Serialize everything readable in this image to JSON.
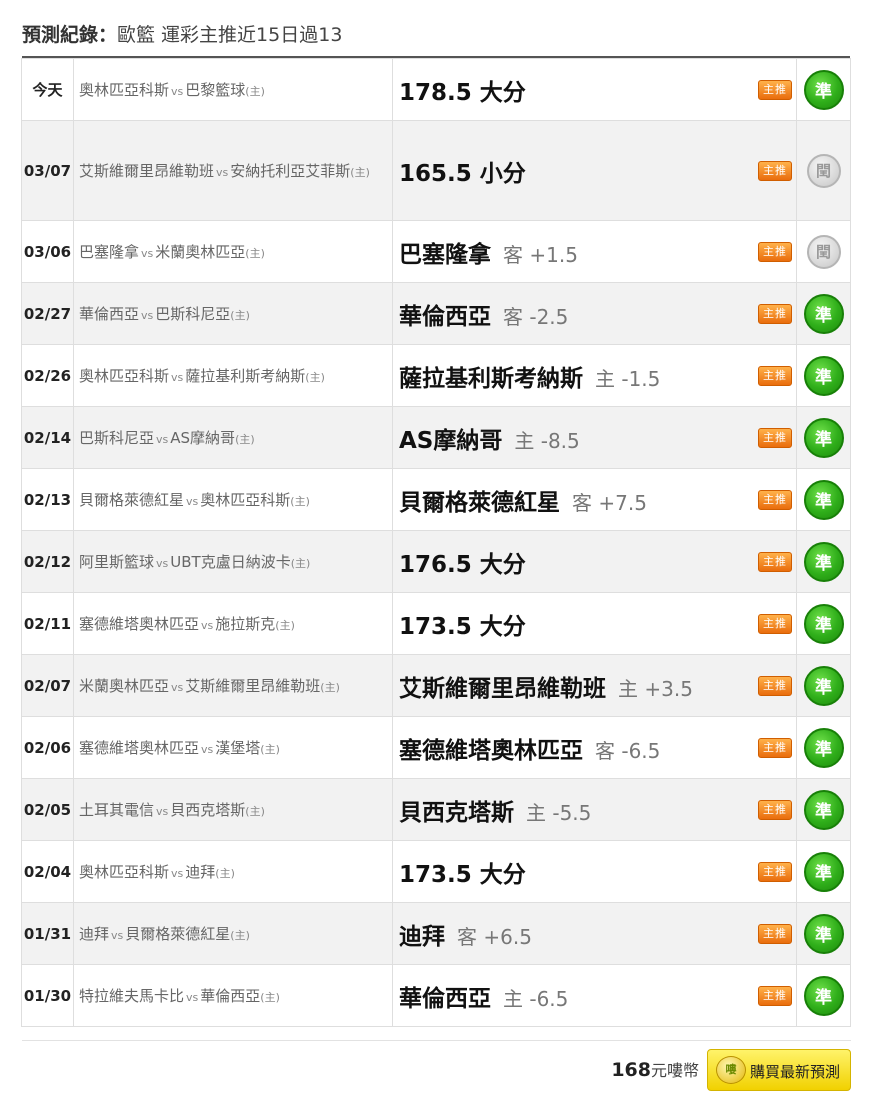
{
  "header": {
    "label": "預測紀錄：",
    "subtitle": "歐籃 運彩主推近15日過13"
  },
  "labels": {
    "vs": "vs",
    "home_mark": "(主)",
    "rec_badge": "主推"
  },
  "colors": {
    "hit": "#2fae1a",
    "miss": "#c8c8c8",
    "rec_badge": "#f08a1c",
    "buy_button": "#ffe82a"
  },
  "icons": {
    "hit": "green-circle-icon",
    "miss": "grey-circle-icon",
    "rec": "orange-badge-icon",
    "coin": "gold-coin-icon"
  },
  "records": [
    {
      "date": "今天",
      "home": "奧林匹亞科斯",
      "away": "巴黎籃球",
      "pick": "178.5 大分",
      "line": "",
      "result": "準",
      "status": "hit"
    },
    {
      "date": "03/07",
      "home": "艾斯維爾里昂維勒班",
      "away": "安納托利亞艾菲斯",
      "pick": "165.5 小分",
      "line": "",
      "result": "閏",
      "status": "miss"
    },
    {
      "date": "03/06",
      "home": "巴塞隆拿",
      "away": "米蘭奧林匹亞",
      "pick": "巴塞隆拿",
      "line": "客 +1.5",
      "result": "閏",
      "status": "miss"
    },
    {
      "date": "02/27",
      "home": "華倫西亞",
      "away": "巴斯科尼亞",
      "pick": "華倫西亞",
      "line": "客 -2.5",
      "result": "準",
      "status": "hit"
    },
    {
      "date": "02/26",
      "home": "奧林匹亞科斯",
      "away": "薩拉基利斯考納斯",
      "pick": "薩拉基利斯考納斯",
      "line": "主 -1.5",
      "result": "準",
      "status": "hit"
    },
    {
      "date": "02/14",
      "home": "巴斯科尼亞",
      "away": "AS摩納哥",
      "pick": "AS摩納哥",
      "line": "主 -8.5",
      "result": "準",
      "status": "hit"
    },
    {
      "date": "02/13",
      "home": "貝爾格萊德紅星",
      "away": "奧林匹亞科斯",
      "pick": "貝爾格萊德紅星",
      "line": "客 +7.5",
      "result": "準",
      "status": "hit"
    },
    {
      "date": "02/12",
      "home": "阿里斯籃球",
      "away": "UBT克盧日納波卡",
      "pick": "176.5 大分",
      "line": "",
      "result": "準",
      "status": "hit"
    },
    {
      "date": "02/11",
      "home": "塞德維塔奧林匹亞",
      "away": "施拉斯克",
      "pick": "173.5 大分",
      "line": "",
      "result": "準",
      "status": "hit"
    },
    {
      "date": "02/07",
      "home": "米蘭奧林匹亞",
      "away": "艾斯維爾里昂維勒班",
      "pick": "艾斯維爾里昂維勒班",
      "line": "主 +3.5",
      "result": "準",
      "status": "hit"
    },
    {
      "date": "02/06",
      "home": "塞德維塔奧林匹亞",
      "away": "漢堡塔",
      "pick": "塞德維塔奧林匹亞",
      "line": "客 -6.5",
      "result": "準",
      "status": "hit"
    },
    {
      "date": "02/05",
      "home": "土耳其電信",
      "away": "貝西克塔斯",
      "pick": "貝西克塔斯",
      "line": "主 -5.5",
      "result": "準",
      "status": "hit"
    },
    {
      "date": "02/04",
      "home": "奧林匹亞科斯",
      "away": "迪拜",
      "pick": "173.5 大分",
      "line": "",
      "result": "準",
      "status": "hit"
    },
    {
      "date": "01/31",
      "home": "迪拜",
      "away": "貝爾格萊德紅星",
      "pick": "迪拜",
      "line": "客 +6.5",
      "result": "準",
      "status": "hit"
    },
    {
      "date": "01/30",
      "home": "特拉維夫馬卡比",
      "away": "華倫西亞",
      "pick": "華倫西亞",
      "line": "主 -6.5",
      "result": "準",
      "status": "hit"
    }
  ],
  "footer": {
    "price": "168",
    "unit": "元嘍幣",
    "coin_text": "嘍",
    "buy_label": "購買最新預測"
  }
}
